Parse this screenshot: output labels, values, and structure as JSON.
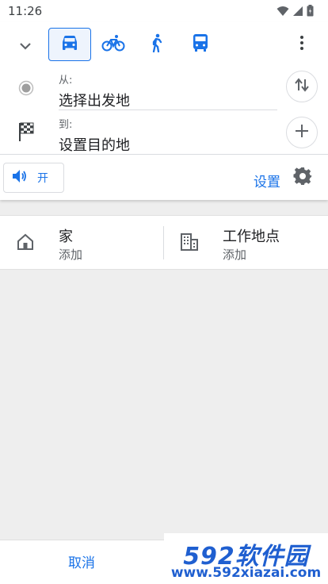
{
  "status_bar": {
    "time": "11:26",
    "icons": [
      "wifi-icon",
      "signal-icon",
      "battery-icon"
    ]
  },
  "travel_modes": [
    {
      "name": "car-icon",
      "selected": true
    },
    {
      "name": "bicycle-icon",
      "selected": false
    },
    {
      "name": "walk-icon",
      "selected": false
    },
    {
      "name": "transit-icon",
      "selected": false
    }
  ],
  "route": {
    "from_label": "从:",
    "from_placeholder": "选择出发地",
    "to_label": "到:",
    "to_placeholder": "设置目的地"
  },
  "voice": {
    "label": "开",
    "icon": "volume-icon"
  },
  "settings": {
    "label": "设置",
    "icon": "gear-icon"
  },
  "places": {
    "home": {
      "title": "家",
      "subtitle": "添加",
      "icon": "home-icon"
    },
    "work": {
      "title": "工作地点",
      "subtitle": "添加",
      "icon": "building-icon"
    }
  },
  "bottom_bar": {
    "cancel_label": "取消"
  },
  "watermark": {
    "logo_text": "592软件园",
    "url": "www.592xiazai.com"
  },
  "colors": {
    "accent": "#1a73e8",
    "background": "#eeeeee",
    "card": "#ffffff",
    "watermark": "#1f5fd0"
  }
}
